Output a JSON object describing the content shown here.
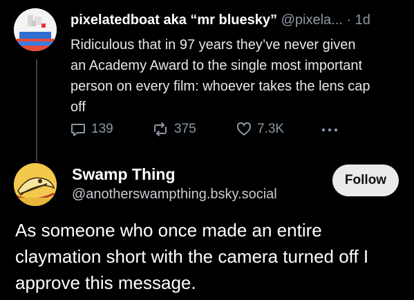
{
  "post1": {
    "display_name": "pixelatedboat aka “mr bluesky”",
    "handle": "@pixela...",
    "separator": "·",
    "time": "1d",
    "text": "Ridiculous that in 97 years they’ve never given an Academy Award to the single most important person on every film: whoever takes the lens cap off",
    "replies": "139",
    "reposts": "375",
    "likes": "7.3K",
    "icons": {
      "reply": "speech-bubble-icon",
      "repost": "repost-arrows-icon",
      "like": "heart-icon",
      "more": "ellipsis-icon"
    }
  },
  "post2": {
    "display_name": "Swamp Thing",
    "handle": "@anotherswampthing.bsky.social",
    "follow_label": "Follow",
    "text": "As someone who once made an entire claymation short with the camera turned off I approve this message."
  },
  "colors": {
    "background": "#000000",
    "muted": "#8b98a5",
    "follow_bg": "#e8eaec"
  }
}
